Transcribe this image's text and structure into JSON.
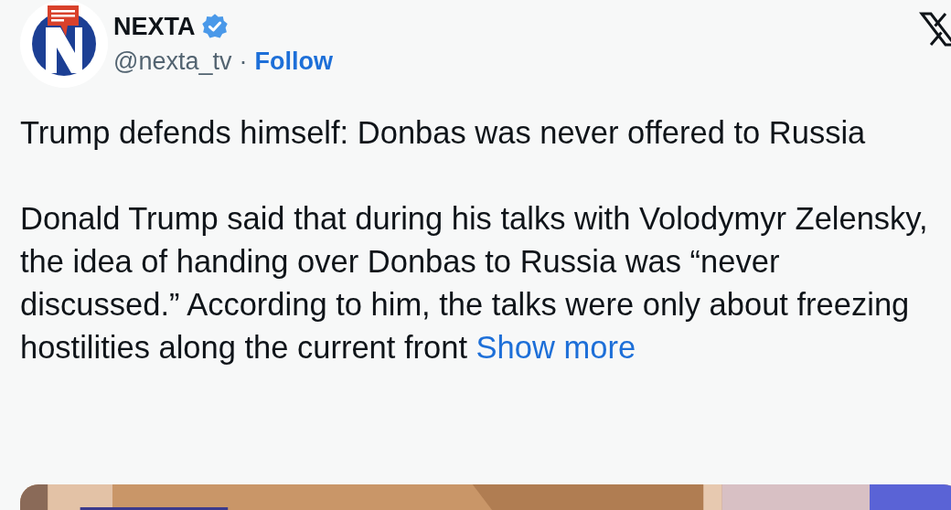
{
  "account": {
    "name": "NEXTA",
    "verified": true,
    "handle": "@nexta_tv",
    "separator": "·",
    "follow": "Follow"
  },
  "post": {
    "paragraphs": [
      "Trump defends himself: Donbas was never offered to Russia",
      "Donald Trump said that during his talks with Volodymyr Zelensky, the idea of handing over Donbas to Russia was “never discussed.” According to him, the talks were only about freezing hostilities along the current front"
    ],
    "show_more": "Show more"
  }
}
